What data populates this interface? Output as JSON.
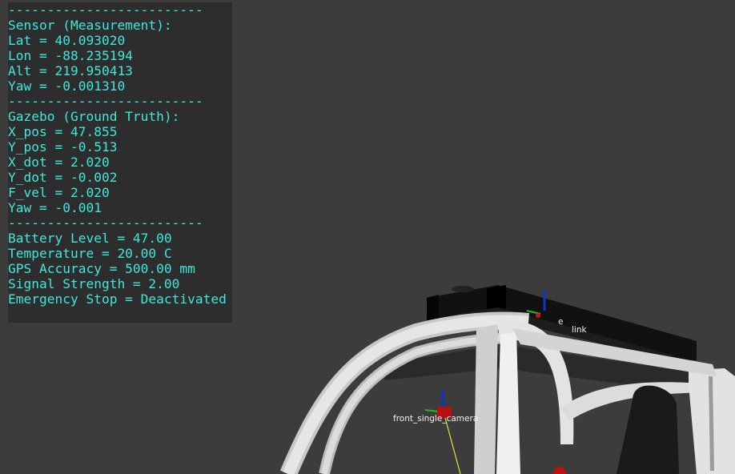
{
  "overlay": {
    "lines": [
      "-------------------------",
      "Sensor (Measurement):",
      "Lat = 40.093020",
      "Lon = -88.235194",
      "Alt = 219.950413",
      "Yaw = -0.001310",
      "-------------------------",
      "Gazebo (Ground Truth):",
      "X_pos = 47.855",
      "Y_pos = -0.513",
      "X_dot = 2.020",
      "Y_dot = -0.002",
      "F_vel = 2.020",
      "Yaw = -0.001",
      "-------------------------",
      "Battery Level = 47.00",
      "Temperature = 20.00 C",
      "GPS Accuracy = 500.00 mm",
      "Signal Strength = 2.00",
      "Emergency Stop = Deactivated"
    ]
  },
  "scene": {
    "frame_labels": {
      "camera": "front_single_camera",
      "top_frame": "e",
      "link": "link"
    },
    "colors": {
      "background": "#3c3c3c",
      "vehicle_frame": "#d9d9d9",
      "roof_rack": "#121212",
      "overlay_text": "#3fe7dc",
      "axis_x": "#cc1111",
      "axis_y": "#22bb22",
      "axis_z": "#1133cc"
    }
  }
}
